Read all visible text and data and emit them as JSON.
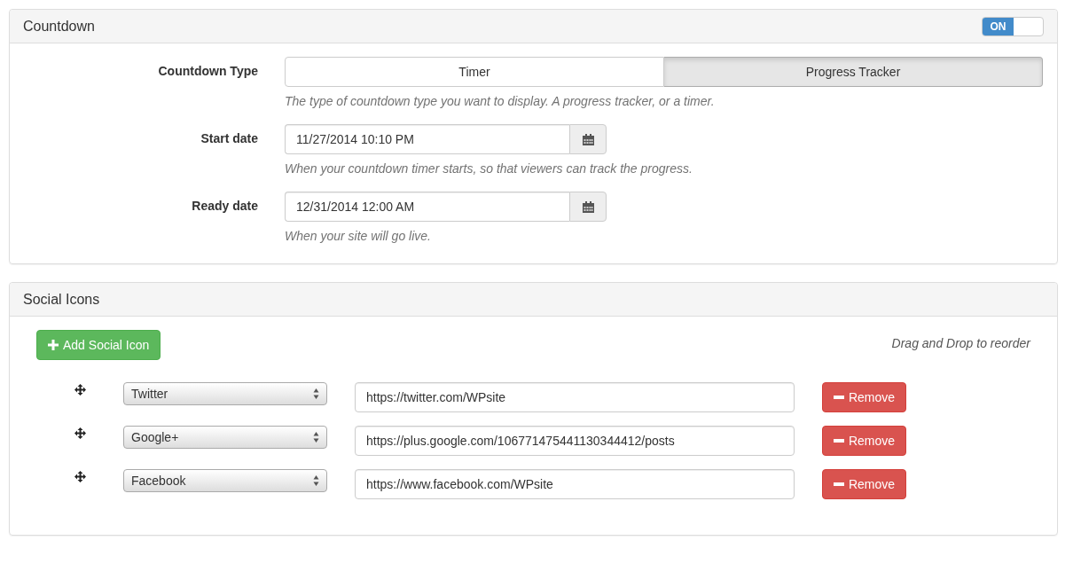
{
  "countdown": {
    "title": "Countdown",
    "toggle": {
      "label": "ON",
      "on": true
    },
    "fields": [
      {
        "kind": "segmented",
        "label": "Countdown Type",
        "options": [
          {
            "label": "Timer",
            "selected": false
          },
          {
            "label": "Progress Tracker",
            "selected": true
          }
        ],
        "help": "The type of countdown type you want to display. A progress tracker, or a timer."
      },
      {
        "kind": "date",
        "label": "Start date",
        "value": "11/27/2014 10:10 PM",
        "help": "When your countdown timer starts, so that viewers can track the progress."
      },
      {
        "kind": "date",
        "label": "Ready date",
        "value": "12/31/2014 12:00 AM",
        "help": "When your site will go live."
      }
    ]
  },
  "social": {
    "title": "Social Icons",
    "add_button": "Add Social Icon",
    "hint": "Drag and Drop to reorder",
    "rows": [
      {
        "network": "Twitter",
        "url": "https://twitter.com/WPsite",
        "remove": "Remove"
      },
      {
        "network": "Google+",
        "url": "https://plus.google.com/106771475441130344412/posts",
        "remove": "Remove"
      },
      {
        "network": "Facebook",
        "url": "https://www.facebook.com/WPsite",
        "remove": "Remove"
      }
    ]
  }
}
